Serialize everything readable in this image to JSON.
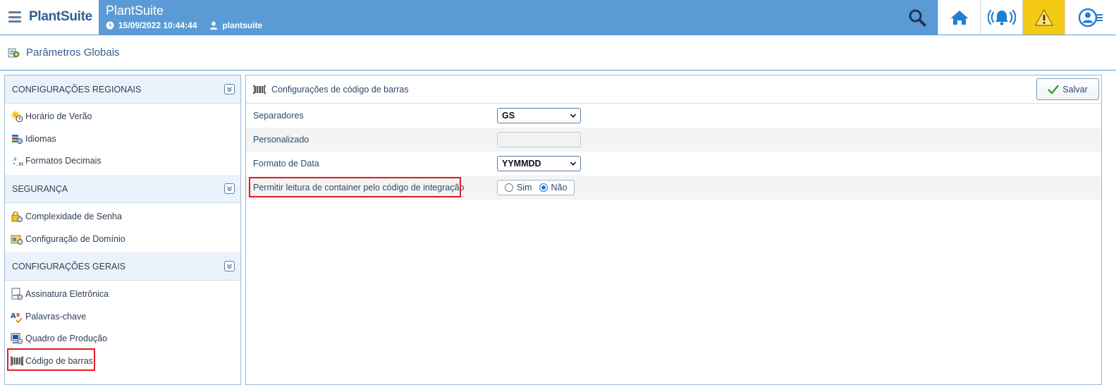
{
  "brand": {
    "name": "PlantSuite"
  },
  "header": {
    "app_title": "PlantSuite",
    "datetime": "15/09/2022 10:44:44",
    "user": "plantsuite"
  },
  "nav": {
    "icons": [
      "search-icon",
      "home-icon",
      "alarm-bell-icon",
      "warning-icon",
      "user-menu-icon"
    ],
    "warning_color": "#f4ca15",
    "accent_color": "#5b9bd5"
  },
  "page": {
    "title": "Parâmetros Globais"
  },
  "sidebar": {
    "sections": [
      {
        "title": "CONFIGURAÇÕES REGIONAIS",
        "items": [
          {
            "label": "Horário de Verão",
            "icon": "sun-clock-icon"
          },
          {
            "label": "Idiomas",
            "icon": "language-icon"
          },
          {
            "label": "Formatos Decimais",
            "icon": "decimal-format-icon"
          }
        ]
      },
      {
        "title": "SEGURANÇA",
        "items": [
          {
            "label": "Complexidade de Senha",
            "icon": "password-lock-icon"
          },
          {
            "label": "Configuração de Domínio",
            "icon": "domain-config-icon"
          }
        ]
      },
      {
        "title": "CONFIGURAÇÕES GERAIS",
        "items": [
          {
            "label": "Assinatura Eletrônica",
            "icon": "signature-icon"
          },
          {
            "label": "Palavras-chave",
            "icon": "keywords-icon"
          },
          {
            "label": "Quadro de Produção",
            "icon": "production-board-icon"
          },
          {
            "label": "Código de barras",
            "icon": "barcode-icon",
            "selected": true
          }
        ]
      }
    ]
  },
  "content": {
    "title": "Configurações de código de barras",
    "save_label": "Salvar",
    "fields": {
      "separadores": {
        "label": "Separadores",
        "value": "GS"
      },
      "personalizado": {
        "label": "Personalizado",
        "value": ""
      },
      "formato_data": {
        "label": "Formato de Data",
        "value": "YYMMDD"
      },
      "permitir": {
        "label": "Permitir leitura de container pelo código de integração",
        "options": [
          "Sim",
          "Não"
        ],
        "selected": "Não"
      }
    }
  }
}
